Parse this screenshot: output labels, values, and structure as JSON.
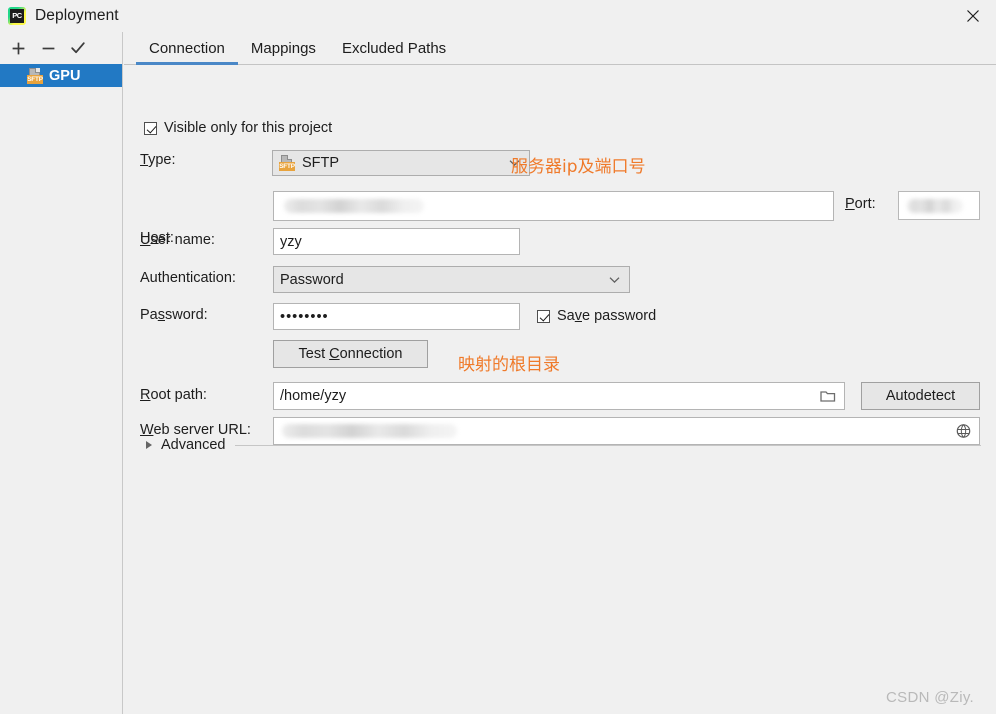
{
  "window": {
    "title": "Deployment",
    "app_icon": "pycharm-icon",
    "close_icon": "close-icon"
  },
  "sidebar": {
    "toolbar": [
      {
        "name": "add-button",
        "icon": "plus-icon",
        "label": "+"
      },
      {
        "name": "remove-button",
        "icon": "minus-icon",
        "label": "−"
      },
      {
        "name": "use-as-default-button",
        "icon": "check-icon",
        "label": "✓"
      }
    ],
    "items": [
      {
        "label": "GPU",
        "icon": "sftp-icon",
        "selected": true
      }
    ]
  },
  "tabs": [
    {
      "label": "Connection",
      "active": true
    },
    {
      "label": "Mappings",
      "active": false
    },
    {
      "label": "Excluded Paths",
      "active": false
    }
  ],
  "form": {
    "visible_only_checkbox": {
      "label": "Visible only for this project",
      "checked": true
    },
    "type": {
      "label_pre": "",
      "label_mnemonic": "T",
      "label_post": "ype:",
      "value": "SFTP",
      "icon": "sftp-icon",
      "caret": "chevron-down-icon"
    },
    "host": {
      "label_pre": "H",
      "label_mnemonic": "o",
      "label_post": "st:",
      "value": "",
      "redacted": true
    },
    "port": {
      "label_pre": "",
      "label_mnemonic": "P",
      "label_post": "ort:",
      "value": "",
      "redacted": true
    },
    "username": {
      "label_pre": "",
      "label_mnemonic": "U",
      "label_post": "ser name:",
      "value": "yzy"
    },
    "authentication": {
      "label": "Authentication:",
      "value": "Password",
      "caret": "chevron-down-icon"
    },
    "password": {
      "label_pre": "Pa",
      "label_mnemonic": "s",
      "label_post": "sword:",
      "value": "••••••••"
    },
    "save_password": {
      "label_pre": "Sa",
      "label_mnemonic": "v",
      "label_post": "e password",
      "checked": true
    },
    "test_connection_button": {
      "label_pre": "Test ",
      "label_mnemonic": "C",
      "label_post": "onnection"
    },
    "root_path": {
      "label_pre": "",
      "label_mnemonic": "R",
      "label_post": "oot path:",
      "value": "/home/yzy",
      "browse_icon": "folder-icon"
    },
    "autodetect_button": {
      "label": "Autodetect"
    },
    "web_server_url": {
      "label_pre": "",
      "label_mnemonic": "W",
      "label_post": "eb server URL:",
      "value": "",
      "redacted": true,
      "open_icon": "globe-icon"
    },
    "advanced": {
      "label": "Advanced",
      "expanded": false,
      "arrow_icon": "triangle-right-icon"
    }
  },
  "annotations": [
    {
      "text": "服务器ip及端口号",
      "color": "#ef7a2a"
    },
    {
      "text": "映射的根目录",
      "color": "#ef7a2a"
    }
  ],
  "watermark": {
    "text": "CSDN @Ziy."
  },
  "colors": {
    "selection_blue": "#2279c4",
    "tab_underline": "#4a88c7",
    "annotation_orange": "#ef7a2a",
    "panel_bg": "#f0f0f0",
    "field_bg": "#ffffff",
    "combo_bg": "#e6e6e6"
  }
}
